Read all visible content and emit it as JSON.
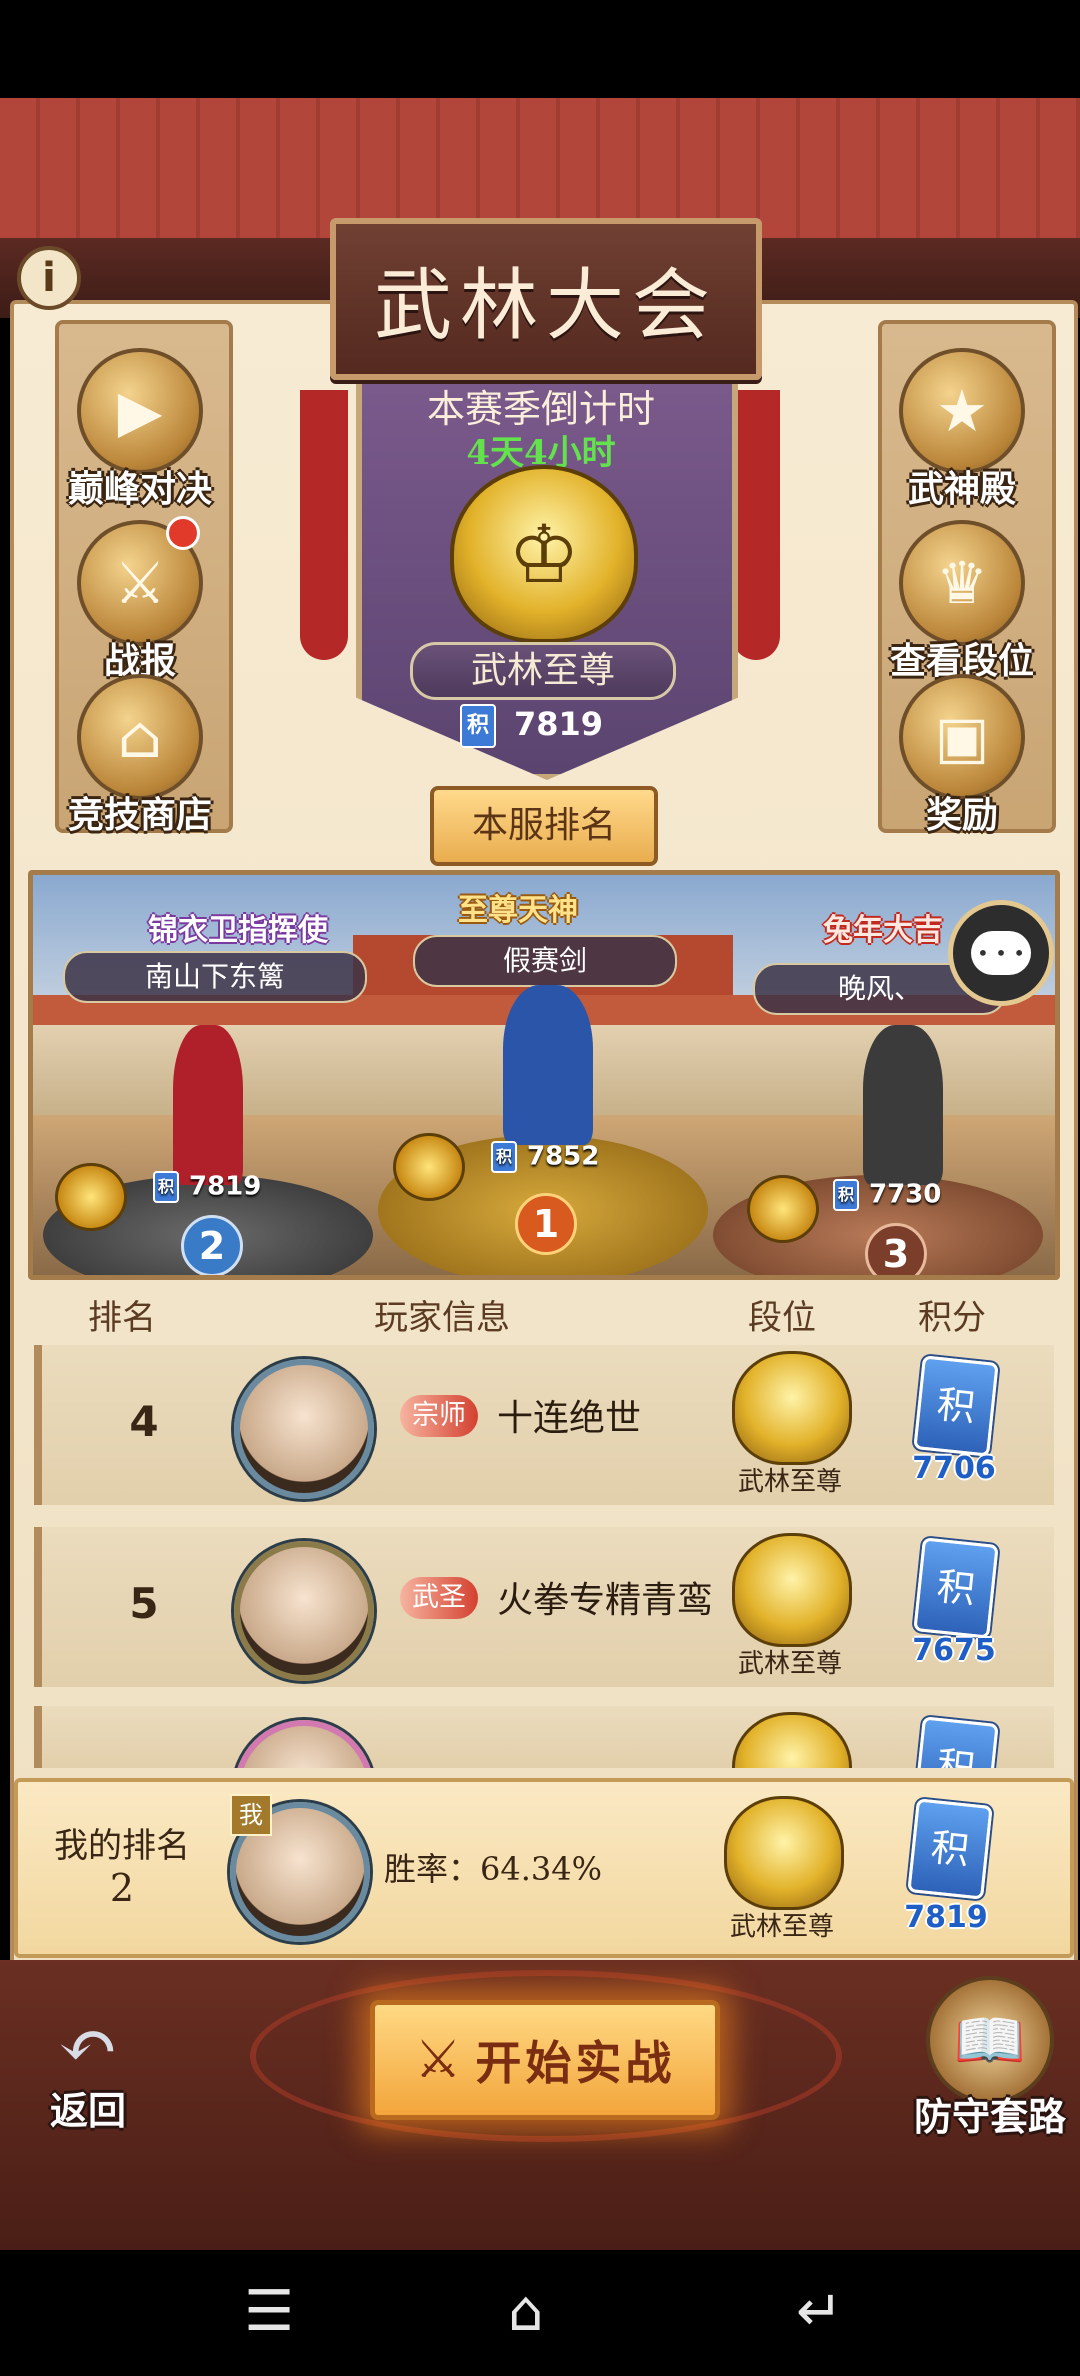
{
  "title": "武林大会",
  "season": {
    "countdown_label": "本赛季倒计时",
    "countdown_value": "4天4小时",
    "rank_title": "武林至尊",
    "score": "7819",
    "server_rank_button": "本服排名"
  },
  "left_menu": [
    {
      "label": "巅峰对决",
      "icon": "play-icon"
    },
    {
      "label": "战报",
      "icon": "battle-report-icon",
      "notification": true
    },
    {
      "label": "竞技商店",
      "icon": "shop-icon"
    }
  ],
  "right_menu": [
    {
      "label": "武神殿",
      "icon": "shield-star-icon"
    },
    {
      "label": "查看段位",
      "icon": "dragon-icon"
    },
    {
      "label": "奖励",
      "icon": "treasure-chest-icon"
    }
  ],
  "podium": [
    {
      "place": "2",
      "title_badge": "锦衣卫指挥使",
      "name": "南山下东篱",
      "score": "7819"
    },
    {
      "place": "1",
      "title_badge": "至尊天神",
      "name": "假赛剑",
      "score": "7852"
    },
    {
      "place": "3",
      "title_badge": "兔年大吉",
      "name": "晚风、",
      "score": "7730"
    }
  ],
  "table_headers": {
    "rank": "排名",
    "player": "玩家信息",
    "tier": "段位",
    "score": "积分"
  },
  "rows": [
    {
      "rank": "4",
      "title_tag": "宗师",
      "name": "十连绝世",
      "tier": "武林至尊",
      "score": "7706"
    },
    {
      "rank": "5",
      "title_tag": "武圣",
      "name": "火拳专精青鸾",
      "tier": "武林至尊",
      "score": "7675"
    }
  ],
  "my_rank": {
    "label": "我的排名",
    "value": "2",
    "me_badge": "我",
    "winrate": "胜率：64.34%",
    "tier": "武林至尊",
    "score": "7819"
  },
  "score_icon_char": "积",
  "bottom": {
    "back": "返回",
    "start": "开始实战",
    "defense": "防守套路"
  },
  "colors": {
    "accent": "#e9ad4f",
    "countdown_green": "#63e24d",
    "score_blue": "#1f5ec5",
    "roof_red": "#b2463b"
  }
}
